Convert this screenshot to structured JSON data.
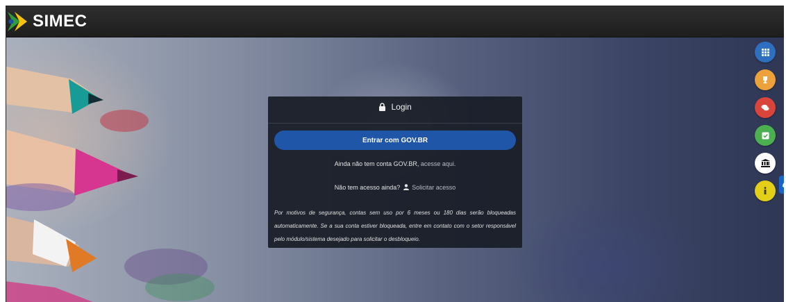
{
  "app": {
    "logo_text": "SIMEC"
  },
  "login": {
    "title": "Login",
    "govbr_button": "Entrar com  GOV.BR",
    "no_account_text": "Ainda não tem conta GOV.BR,",
    "no_account_link": "acesse aqui.",
    "no_access_text": "Não tem acesso ainda?",
    "request_access_link": "Solicitar acesso",
    "notice": "Por motivos de segurança, contas sem uso por 6 meses ou 180 dias serão bloqueadas automaticamente. Se a sua conta estiver bloqueada, entre em contato com o setor responsável pelo módulo/sistema desejado para solicitar o desbloqueio."
  },
  "side_buttons": [
    {
      "name": "apps-grid-icon",
      "color": "#2f6fbf"
    },
    {
      "name": "trophy-icon",
      "color": "#eca13a"
    },
    {
      "name": "chat-icon",
      "color": "#d9443b"
    },
    {
      "name": "checkbox-icon",
      "color": "#4caf50"
    },
    {
      "name": "bank-icon",
      "color": "#ffffff"
    },
    {
      "name": "info-icon",
      "color": "#e3cf17"
    }
  ],
  "accessibility_tab": {
    "icon": "hands-sign-language-icon",
    "color": "#1c63c9"
  }
}
